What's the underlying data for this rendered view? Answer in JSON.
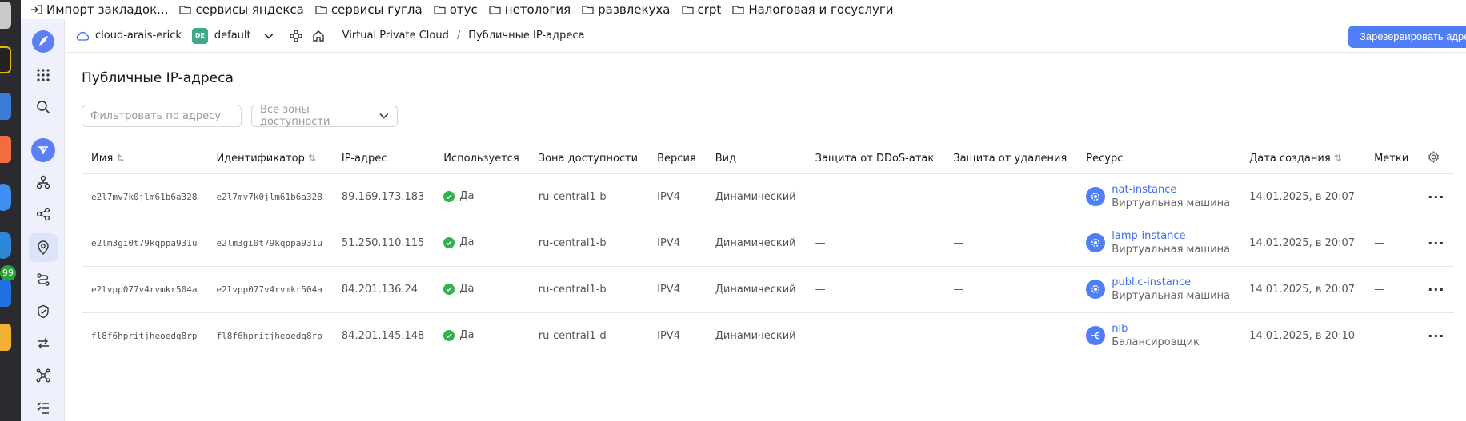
{
  "bookmarks": [
    {
      "label": "Импорт закладок...",
      "icon": "import-icon"
    },
    {
      "label": "сервисы яндекса",
      "icon": "folder-icon"
    },
    {
      "label": "сервисы гугла",
      "icon": "folder-icon"
    },
    {
      "label": "отус",
      "icon": "folder-icon"
    },
    {
      "label": "нетология",
      "icon": "folder-icon"
    },
    {
      "label": "развлекуха",
      "icon": "folder-icon"
    },
    {
      "label": "crpt",
      "icon": "folder-icon"
    },
    {
      "label": "Налоговая  и госуслуги",
      "icon": "folder-icon"
    }
  ],
  "dock": {
    "badge": "99"
  },
  "header": {
    "cloud_name": "cloud-arais-erick",
    "folder_badge": "DE",
    "folder_name": "default",
    "breadcrumb": [
      "Virtual Private Cloud",
      "Публичные IP-адреса"
    ],
    "breadcrumb_separator": "/",
    "reserve_button": "Зарезервировать адрес"
  },
  "page": {
    "title": "Публичные IP-адреса",
    "filter_placeholder": "Фильтровать по адресу",
    "zone_select": "Все зоны доступности"
  },
  "table": {
    "columns": [
      "Имя",
      "Идентификатор",
      "IP-адрес",
      "Используется",
      "Зона доступности",
      "Версия",
      "Вид",
      "Защита от DDoS-атак",
      "Защита от удаления",
      "Ресурс",
      "Дата создания",
      "Метки"
    ],
    "rows": [
      {
        "name": "e2l7mv7k0jlm61b6a328",
        "id": "e2l7mv7k0jlm61b6a328",
        "ip": "89.169.173.183",
        "used": "Да",
        "zone": "ru-central1-b",
        "version": "IPV4",
        "kind": "Динамический",
        "ddos": "—",
        "deletion": "—",
        "resource": "nat-instance",
        "resource_type": "Виртуальная машина",
        "resource_icon": "vm-icon",
        "created": "14.01.2025, в 20:07",
        "labels": "—"
      },
      {
        "name": "e2lm3gi0t79kqppa931u",
        "id": "e2lm3gi0t79kqppa931u",
        "ip": "51.250.110.115",
        "used": "Да",
        "zone": "ru-central1-b",
        "version": "IPV4",
        "kind": "Динамический",
        "ddos": "—",
        "deletion": "—",
        "resource": "lamp-instance",
        "resource_type": "Виртуальная машина",
        "resource_icon": "vm-icon",
        "created": "14.01.2025, в 20:07",
        "labels": "—"
      },
      {
        "name": "e2lvpp077v4rvmkr504a",
        "id": "e2lvpp077v4rvmkr504a",
        "ip": "84.201.136.24",
        "used": "Да",
        "zone": "ru-central1-b",
        "version": "IPV4",
        "kind": "Динамический",
        "ddos": "—",
        "deletion": "—",
        "resource": "public-instance",
        "resource_type": "Виртуальная машина",
        "resource_icon": "vm-icon",
        "created": "14.01.2025, в 20:07",
        "labels": "—"
      },
      {
        "name": "fl8f6hpritjheoedg8rp",
        "id": "fl8f6hpritjheoedg8rp",
        "ip": "84.201.145.148",
        "used": "Да",
        "zone": "ru-central1-d",
        "version": "IPV4",
        "kind": "Динамический",
        "ddos": "—",
        "deletion": "—",
        "resource": "nlb",
        "resource_type": "Балансировщик",
        "resource_icon": "load-balancer-icon",
        "created": "14.01.2025, в 20:10",
        "labels": "—"
      }
    ]
  },
  "colors": {
    "accent": "#4f7ef7",
    "success": "#2fb34d",
    "nav_bg": "#eef1fb"
  }
}
